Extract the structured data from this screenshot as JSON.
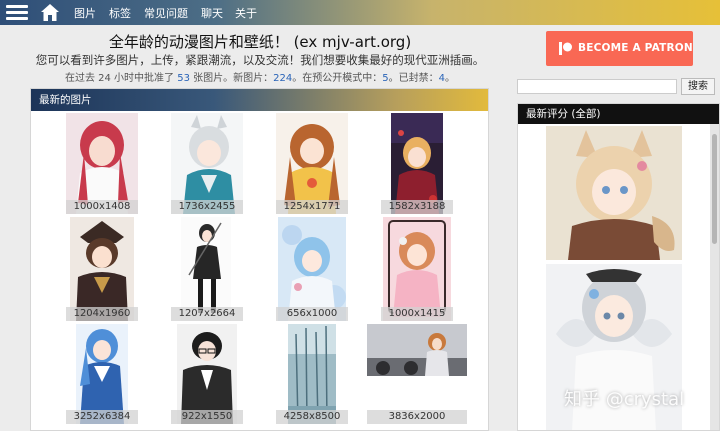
{
  "nav": {
    "items": [
      "图片",
      "标签",
      "常见问题",
      "聊天",
      "关于"
    ]
  },
  "header": {
    "title": "全年龄的动漫图片和壁纸！ (ex mjv-art.org)",
    "description": "您可以看到许多图片，上传，紧跟潮流，以及交流！我们想要收集最好的现代亚洲插画。",
    "stats": {
      "p1": "在过去 24 小时中批准了",
      "approved": "53",
      "p2": "张图片。新图片：",
      "new": "224",
      "p3": "。在预公开模式中：",
      "preview": "5",
      "p4": "。已封禁：",
      "banned": "4",
      "p5": "。"
    }
  },
  "patron": {
    "label": "BECOME A PATRON"
  },
  "search": {
    "placeholder": "",
    "button": "搜索"
  },
  "gallery": {
    "title": "最新的图片",
    "items": [
      {
        "resolution": "1000x1408"
      },
      {
        "resolution": "1736x2455"
      },
      {
        "resolution": "1254x1771"
      },
      {
        "resolution": "1582x3188"
      },
      {
        "resolution": "1204x1960"
      },
      {
        "resolution": "1207x2664"
      },
      {
        "resolution": "656x1000"
      },
      {
        "resolution": "1000x1415"
      },
      {
        "resolution": "3252x6384"
      },
      {
        "resolution": "922x1550"
      },
      {
        "resolution": "4258x8500"
      },
      {
        "resolution": "3836x2000"
      }
    ]
  },
  "sidebar": {
    "title": "最新评分 (全部)"
  },
  "watermark": "知乎 @crystal",
  "colors": {
    "patron": "#f96854",
    "link": "#2a64b8",
    "sidebar_header": "#111111"
  }
}
